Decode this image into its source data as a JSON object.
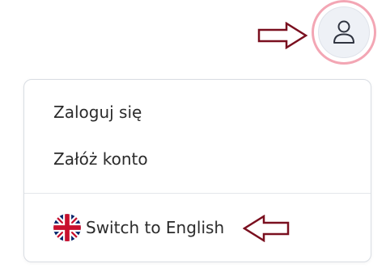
{
  "user_menu": {
    "avatar_icon": "user-icon",
    "items": [
      {
        "label": "Zaloguj się"
      },
      {
        "label": "Załóż konto"
      }
    ],
    "language_switch": {
      "label": "Switch to English",
      "icon": "uk-flag-icon"
    }
  },
  "colors": {
    "focus_ring": "#f3a6b4",
    "avatar_bg": "#eef1f6",
    "annotation_arrow": "#7a0f1f",
    "text": "#2b2b2b"
  }
}
